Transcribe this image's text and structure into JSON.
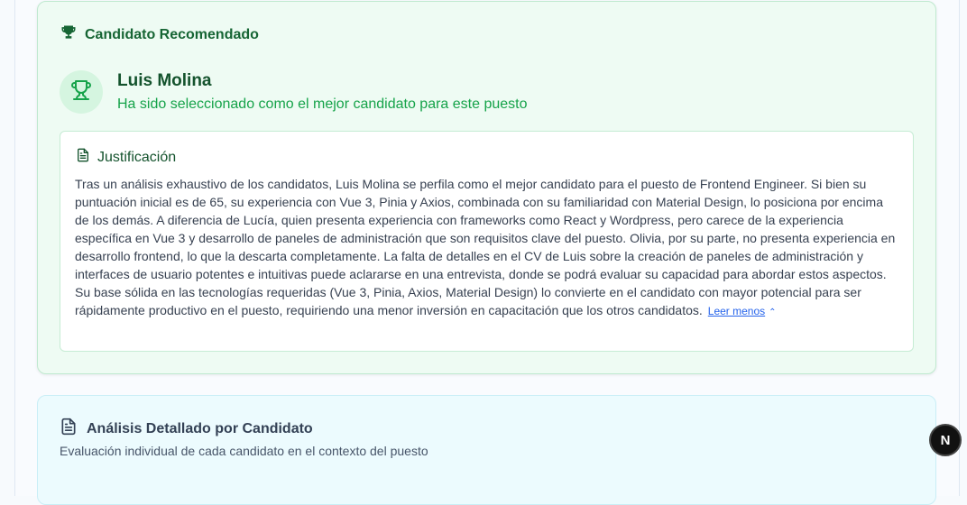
{
  "recommended": {
    "section_title": "Candidato Recomendado",
    "candidate_name": "Luis Molina",
    "candidate_subtitle": "Ha sido seleccionado como el mejor candidato para este puesto",
    "justification": {
      "title": "Justificación",
      "text": "Tras un análisis exhaustivo de los candidatos, Luis Molina se perfila como el mejor candidato para el puesto de Frontend Engineer. Si bien su puntuación inicial es de 65, su experiencia con Vue 3, Pinia y Axios, combinada con su familiaridad con Material Design, lo posiciona por encima de los demás. A diferencia de Lucía, quien presenta experiencia con frameworks como React y Wordpress, pero carece de la experiencia específica en Vue 3 y desarrollo de paneles de administración que son requisitos clave del puesto. Olivia, por su parte, no presenta experiencia en desarrollo frontend, lo que la descarta completamente. La falta de detalles en el CV de Luis sobre la creación de paneles de administración y interfaces de usuario potentes e intuitivas puede aclararse en una entrevista, donde se podrá evaluar su capacidad para abordar estos aspectos. Su base sólida en las tecnologías requeridas (Vue 3, Pinia, Axios, Material Design) lo convierte en el candidato con mayor potencial para ser rápidamente productivo en el puesto, requiriendo una menor inversión en capacitación que los otros candidatos.",
      "toggle_label": "Leer menos"
    }
  },
  "analysis": {
    "title": "Análisis Detallado por Candidato",
    "subtitle": "Evaluación individual de cada candidato en el contexto del puesto"
  },
  "overlay_button": {
    "label": "N"
  },
  "icons": {
    "trophy": "trophy-icon",
    "document": "document-icon",
    "chevron_up": "chevron-up-icon"
  },
  "colors": {
    "accent_green": "#16a34a",
    "dark_green": "#166534",
    "link_blue": "#2563eb"
  }
}
